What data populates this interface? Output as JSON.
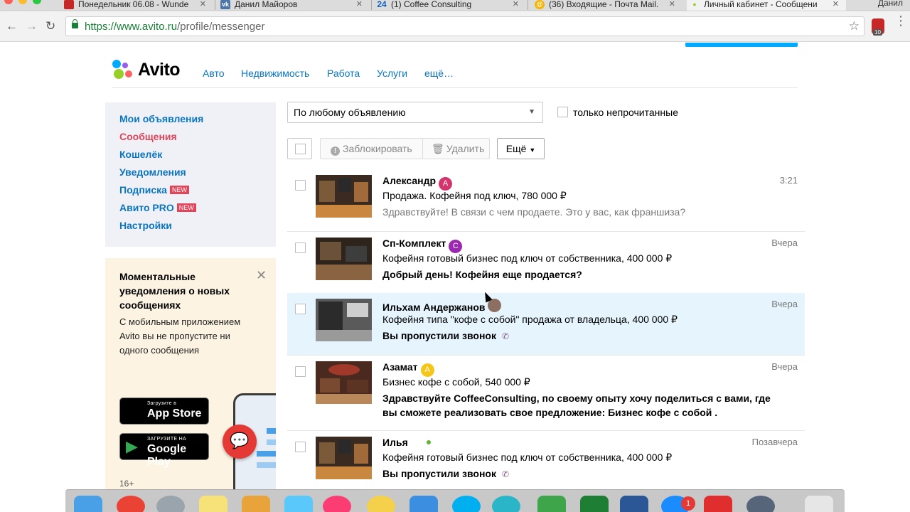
{
  "browser": {
    "tabs": [
      {
        "title": "Понедельник 06.08 - Wunde",
        "fav_color": "#c62828",
        "fav_text": ""
      },
      {
        "title": "Данил Майоров",
        "fav_color": "#4a76a8",
        "fav_text": "vk"
      },
      {
        "title": "(1) Coffee Consulting",
        "fav_color": "#1565c0",
        "fav_text": "24"
      },
      {
        "title": "(36) Входящие - Почта Mail.",
        "fav_color": "#f4b400",
        "fav_text": "@"
      },
      {
        "title": "Личный кабинет - Сообщени",
        "fav_color": "#97cf26",
        "fav_text": "●"
      }
    ],
    "user_name": "Данил",
    "url_host": "https://www.avito.ru",
    "url_path": "/profile/messenger",
    "ext_badge": "10"
  },
  "header": {
    "logo_text": "Avito",
    "nav": [
      "Авто",
      "Недвижимость",
      "Работа",
      "Услуги",
      "ещё…"
    ]
  },
  "sidebar": {
    "items": [
      {
        "label": "Мои объявления",
        "new": ""
      },
      {
        "label": "Сообщения",
        "new": ""
      },
      {
        "label": "Кошелёк",
        "new": ""
      },
      {
        "label": "Уведомления",
        "new": ""
      },
      {
        "label": "Подписка",
        "new": "NEW"
      },
      {
        "label": "Авито PRO",
        "new": "NEW"
      },
      {
        "label": "Настройки",
        "new": ""
      }
    ]
  },
  "promo": {
    "title": "Моментальные уведомления о новых сообщениях",
    "text": "С мобильным приложением Avito вы не пропустите ни одного сообщения",
    "appstore_small": "Загрузите в",
    "appstore_big": "App Store",
    "gplay_small": "ЗАГРУЗИТЕ НА",
    "gplay_big": "Google Play",
    "age": "16+"
  },
  "filters": {
    "select_value": "По любому объявлению",
    "unread_label": "только непрочитанные"
  },
  "actions": {
    "block": "Заблокировать",
    "delete": "Удалить",
    "more": "Ещё"
  },
  "messages": [
    {
      "name": "Александр",
      "avatar_letter": "А",
      "avatar_color": "#d6336c",
      "time": "3:21",
      "item": "Продажа. Кофейня под ключ, 780 000 ₽",
      "text": "Здравствуйте! В связи с чем продаете. Это у вас, как франшиза?"
    },
    {
      "name": "Сп-Комплект",
      "avatar_letter": "С",
      "avatar_color": "#9c27b0",
      "time": "Вчера",
      "item": "Кофейня готовый бизнес под ключ от собственника, 400 000 ₽",
      "text": "Добрый день! Кофейня еще продается?"
    },
    {
      "name": "Ильхам Андержанов",
      "avatar_letter": "",
      "avatar_color": "#8d6e63",
      "time": "Вчера",
      "item": "Кофейня типа \"кофе с собой\" продажа от владельца, 400 000 ₽",
      "text": "Вы пропустили звонок"
    },
    {
      "name": "Азамат",
      "avatar_letter": "А",
      "avatar_color": "#f5c518",
      "time": "Вчера",
      "item": "Бизнес кофе с собой, 540 000 ₽",
      "text": "Здравствуйте CoffeeConsulting, по своему опыту хочу поделиться с вами, где вы сможете реализовать свое предложение: Бизнес кофе с собой ."
    },
    {
      "name": "Илья",
      "avatar_letter": "",
      "avatar_color": "#61b333",
      "time": "Позавчера",
      "item": "Кофейня готовый бизнес под ключ от собственника, 400 000 ₽",
      "text": "Вы пропустили звонок"
    }
  ]
}
